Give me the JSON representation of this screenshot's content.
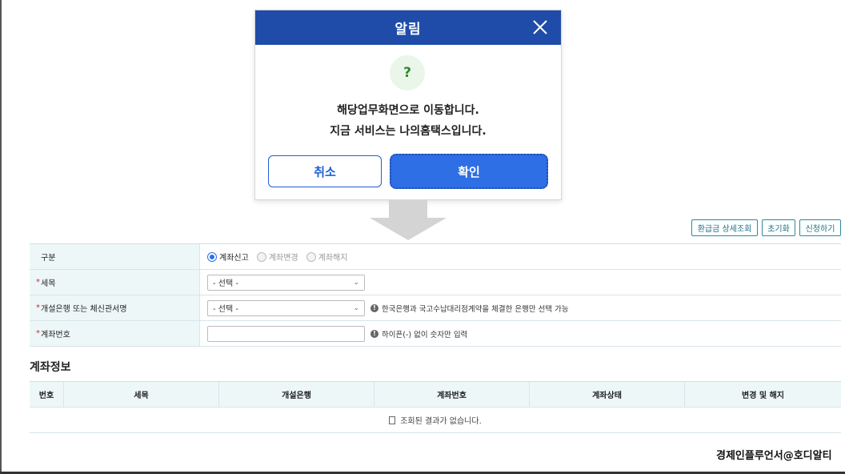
{
  "modal": {
    "title": "알림",
    "icon_symbol": "?",
    "message_line1": "해당업무화면으로 이동합니다.",
    "message_line2": "지금 서비스는 나의홈택스입니다.",
    "cancel_label": "취소",
    "ok_label": "확인"
  },
  "toolbar": {
    "refund_detail_label": "환급금 상세조회",
    "reset_label": "초기화",
    "apply_label": "신청하기"
  },
  "form": {
    "type_label": "구분",
    "type_options": [
      "계좌신고",
      "계좌변경",
      "계좌해지"
    ],
    "tax_label": "세목",
    "tax_select_value": "- 선택 -",
    "bank_label": "개설은행 또는 체신관서명",
    "bank_select_value": "- 선택 -",
    "bank_note": "한국은행과 국고수납대리점계약을 체결한 은행만 선택 가능",
    "account_label": "계좌번호",
    "account_value": "",
    "account_note": "하이픈(-) 없이 숫자만 입력"
  },
  "account_info": {
    "title": "계좌정보",
    "columns": [
      "번호",
      "세목",
      "개설은행",
      "계좌번호",
      "계좌상태",
      "변경 및 해지"
    ],
    "empty_message": "조회된 결과가 없습니다."
  },
  "watermark": "경제인플루언서@호디알티",
  "colors": {
    "header_blue": "#1f4ca8",
    "primary_blue": "#2e6fe6",
    "table_header_bg": "#edf7f8",
    "required_red": "#dd2222"
  }
}
